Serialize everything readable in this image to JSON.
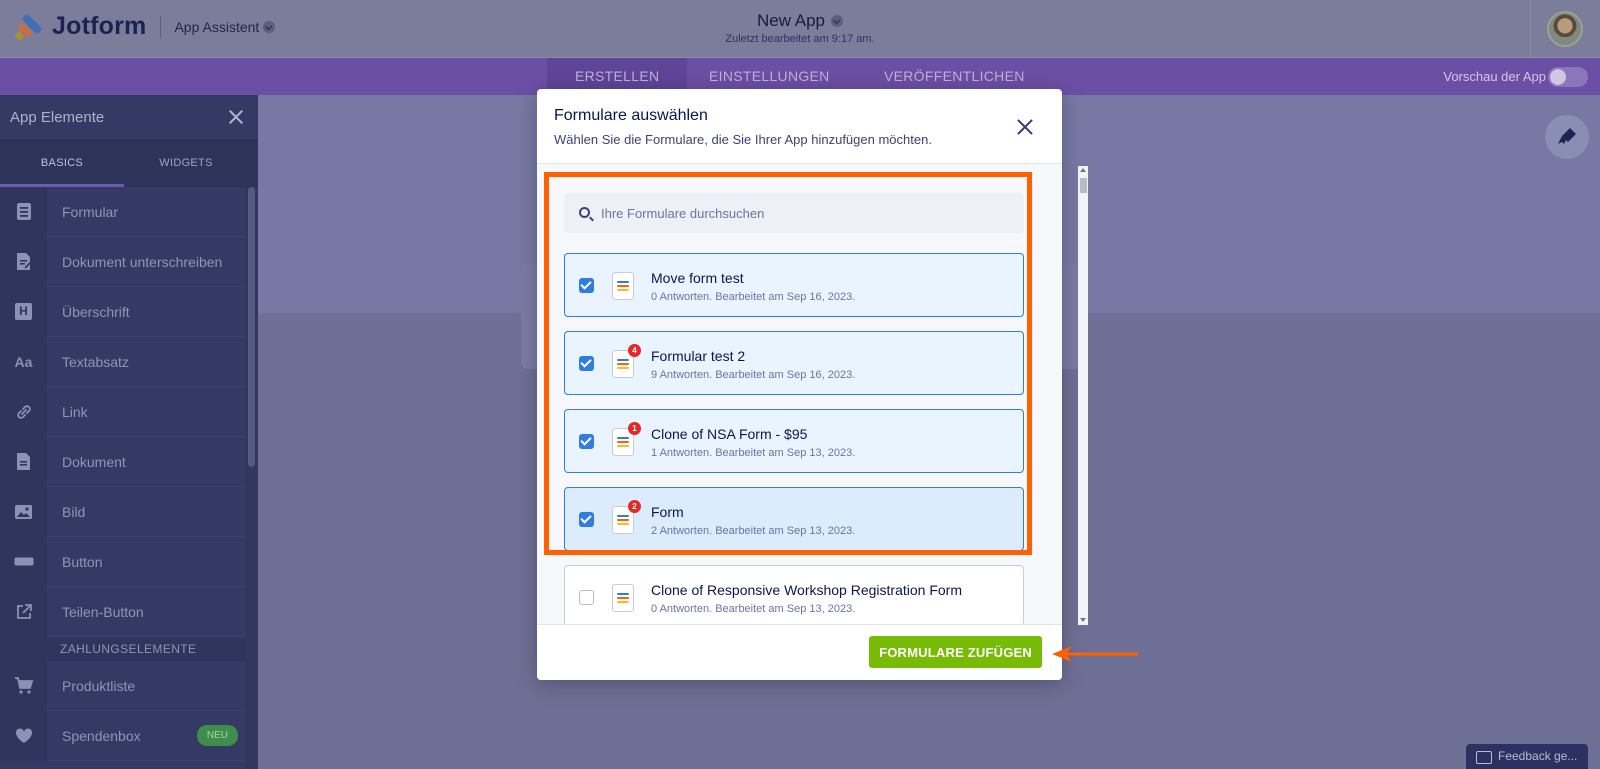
{
  "header": {
    "brand": "Jotform",
    "app_assistant": "App Assistent",
    "app_name": "New App",
    "last_edited": "Zuletzt bearbeitet am 9:17 am."
  },
  "nav": {
    "tabs": [
      {
        "label": "ERSTELLEN",
        "active": true
      },
      {
        "label": "EINSTELLUNGEN",
        "active": false
      },
      {
        "label": "VERÖFFENTLICHEN",
        "active": false
      }
    ],
    "preview_label": "Vorschau der App"
  },
  "sidebar": {
    "title": "App Elemente",
    "tabs": [
      "BASICS",
      "WIDGETS"
    ],
    "items": [
      {
        "label": "Formular",
        "icon": "form-icon"
      },
      {
        "label": "Dokument unterschreiben",
        "icon": "sign-document-icon"
      },
      {
        "label": "Überschrift",
        "icon": "heading-icon",
        "glyph": "H"
      },
      {
        "label": "Textabsatz",
        "icon": "text-icon",
        "glyph": "Aa"
      },
      {
        "label": "Link",
        "icon": "link-icon"
      },
      {
        "label": "Dokument",
        "icon": "document-icon"
      },
      {
        "label": "Bild",
        "icon": "image-icon"
      },
      {
        "label": "Button",
        "icon": "button-icon"
      },
      {
        "label": "Teilen-Button",
        "icon": "share-icon"
      }
    ],
    "section": "ZAHLUNGSELEMENTE",
    "payment_items": [
      {
        "label": "Produktliste",
        "icon": "cart-icon"
      },
      {
        "label": "Spendenbox",
        "icon": "heart-icon",
        "badge": "NEU"
      }
    ]
  },
  "modal": {
    "title": "Formulare auswählen",
    "subtitle": "Wählen Sie die Formulare, die Sie Ihrer App hinzufügen möchten.",
    "search_placeholder": "Ihre Formulare durchsuchen",
    "forms": [
      {
        "name": "Move form test",
        "meta": "0 Antworten. Bearbeitet am Sep 16, 2023.",
        "checked": true,
        "badge": ""
      },
      {
        "name": "Formular test 2",
        "meta": "9 Antworten. Bearbeitet am Sep 16, 2023.",
        "checked": true,
        "badge": "4"
      },
      {
        "name": "Clone of NSA Form - $95",
        "meta": "1 Antworten. Bearbeitet am Sep 13, 2023.",
        "checked": true,
        "badge": "1"
      },
      {
        "name": "Form",
        "meta": "2 Antworten. Bearbeitet am Sep 13, 2023.",
        "checked": true,
        "badge": "2"
      },
      {
        "name": "Clone of Responsive Workshop Registration Form",
        "meta": "0 Antworten. Bearbeitet am Sep 13, 2023.",
        "checked": false,
        "badge": ""
      }
    ],
    "add_button": "FORMULARE ZUFÜGEN"
  },
  "feedback": "Feedback ge...",
  "colors": {
    "accent_purple": "#6b4fa5",
    "checkbox_blue": "#2f7de1",
    "highlight_orange": "#ff6100",
    "add_button_green": "#78bb07"
  }
}
